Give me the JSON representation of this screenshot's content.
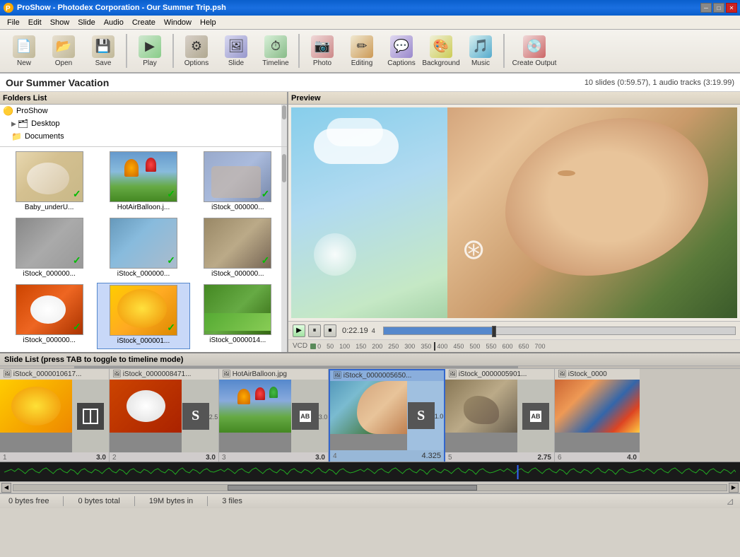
{
  "titlebar": {
    "title": "ProShow - Photodex Corporation - Our Summer Trip.psh",
    "min": "─",
    "max": "□",
    "close": "✕"
  },
  "menubar": {
    "items": [
      "File",
      "Edit",
      "Show",
      "Slide",
      "Audio",
      "Create",
      "Window",
      "Help"
    ]
  },
  "toolbar": {
    "buttons": [
      {
        "id": "new",
        "label": "New",
        "icon": "📄"
      },
      {
        "id": "open",
        "label": "Open",
        "icon": "📂"
      },
      {
        "id": "save",
        "label": "Save",
        "icon": "💾"
      },
      {
        "id": "play",
        "label": "Play",
        "icon": "▶"
      },
      {
        "id": "options",
        "label": "Options",
        "icon": "⚙"
      },
      {
        "id": "slide",
        "label": "Slide",
        "icon": "🖼"
      },
      {
        "id": "timeline",
        "label": "Timeline",
        "icon": "⏱"
      },
      {
        "id": "photo",
        "label": "Photo",
        "icon": "📷"
      },
      {
        "id": "editing",
        "label": "Editing",
        "icon": "✏"
      },
      {
        "id": "captions",
        "label": "Captions",
        "icon": "💬"
      },
      {
        "id": "background",
        "label": "Background",
        "icon": "🎨"
      },
      {
        "id": "music",
        "label": "Music",
        "icon": "🎵"
      },
      {
        "id": "create",
        "label": "Create Output",
        "icon": "💿"
      }
    ]
  },
  "infobar": {
    "title": "Our Summer Vacation",
    "info": "10 slides (0:59.57), 1 audio tracks (3:19.99)"
  },
  "folders": {
    "header": "Folders List",
    "items": [
      {
        "name": "ProShow",
        "icon": "🟡",
        "level": 0
      },
      {
        "name": "Desktop",
        "icon": "🗂",
        "level": 1
      },
      {
        "name": "Documents",
        "icon": "📁",
        "level": 1
      }
    ]
  },
  "files": [
    {
      "label": "Baby_underU...",
      "class": "thumb-baby",
      "checked": true
    },
    {
      "label": "HotAirBalloon.j...",
      "class": "thumb-balloon",
      "checked": true
    },
    {
      "label": "iStock_000000...",
      "class": "thumb-people",
      "checked": true
    },
    {
      "label": "iStock_000000...",
      "class": "thumb-group",
      "checked": true
    },
    {
      "label": "iStock_000000...",
      "class": "thumb-landscape",
      "checked": true
    },
    {
      "label": "iStock_000000...",
      "class": "thumb-rock",
      "checked": true
    },
    {
      "label": "iStock_000000...",
      "class": "thumb-baseball",
      "checked": true
    },
    {
      "label": "iStock_000001...",
      "class": "thumb-flower",
      "checked": true
    },
    {
      "label": "iStock_0000014...",
      "class": "thumb-meadow",
      "checked": false
    }
  ],
  "preview": {
    "header": "Preview",
    "time": "0:22.19",
    "frame": "4",
    "ruler_marks": [
      "0",
      "50",
      "100",
      "150",
      "200",
      "250",
      "300",
      "350",
      "400",
      "450",
      "500",
      "550",
      "600",
      "650",
      "700"
    ],
    "vcd_label": "VCD"
  },
  "slidelist": {
    "header": "Slide List (press TAB to toggle to timeline mode)",
    "slides": [
      {
        "id": 1,
        "title": "iStock_0000010617...",
        "thumb_class": "s-thumb-flower",
        "has_transition": true,
        "transition_type": "plain",
        "number": "1",
        "duration": "3.0",
        "trans_duration": ""
      },
      {
        "id": 2,
        "title": "iStock_0000008471...",
        "thumb_class": "s-thumb-baseball",
        "has_transition": true,
        "transition_type": "plain",
        "number": "2",
        "duration": "3.0",
        "trans_duration": "2.5"
      },
      {
        "id": 3,
        "title": "HotAirBalloon.jpg",
        "thumb_class": "s-thumb-balloon",
        "has_transition": true,
        "transition_type": "ab",
        "number": "3",
        "duration": "3.0",
        "trans_duration": "3.0"
      },
      {
        "id": 4,
        "title": "iStock_0000005650...",
        "thumb_class": "s-thumb-boy",
        "has_transition": true,
        "transition_type": "plain",
        "number": "4",
        "duration": "4.325",
        "selected": true,
        "trans_duration": "1.0"
      },
      {
        "id": 5,
        "title": "iStock_0000005901...",
        "thumb_class": "s-thumb-rock",
        "has_transition": true,
        "transition_type": "ab",
        "number": "5",
        "duration": "2.75",
        "trans_duration": ""
      },
      {
        "id": 6,
        "title": "iStock_0000",
        "thumb_class": "s-thumb-colored-houses",
        "has_transition": false,
        "number": "6",
        "duration": "4.0",
        "trans_duration": ""
      }
    ]
  },
  "statusbar": {
    "free": "0 bytes free",
    "total": "0 bytes total",
    "size": "19M bytes in",
    "files": "3 files"
  }
}
